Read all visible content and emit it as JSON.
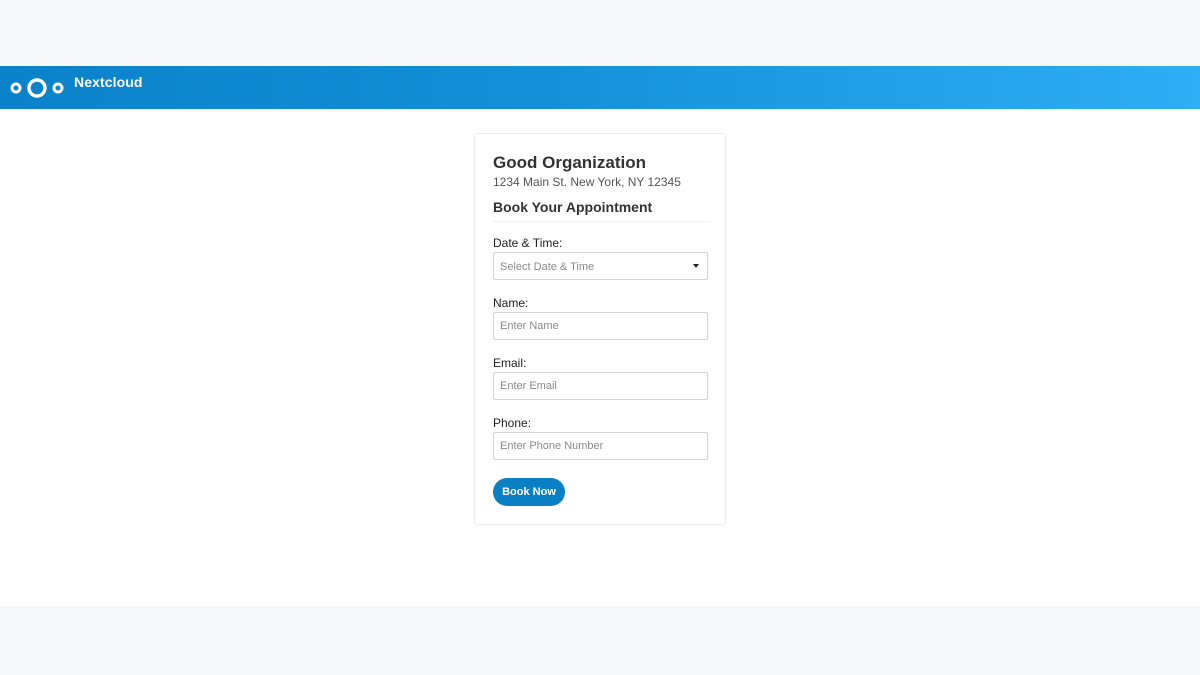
{
  "header": {
    "brand": "Nextcloud",
    "logo_icon": "nextcloud-logo-icon",
    "gradient": [
      "#0a82c9",
      "#2eaef5"
    ]
  },
  "organization": {
    "name": "Good Organization",
    "address": "1234 Main St. New York, NY 12345"
  },
  "form": {
    "title": "Book Your Appointment",
    "date_time": {
      "label": "Date & Time:",
      "placeholder": "Select Date & Time"
    },
    "name": {
      "label": "Name:",
      "placeholder": "Enter Name"
    },
    "email": {
      "label": "Email:",
      "placeholder": "Enter Email"
    },
    "phone": {
      "label": "Phone:",
      "placeholder": "Enter Phone Number"
    },
    "submit_label": "Book Now",
    "accent_color": "#0b7fc4"
  }
}
